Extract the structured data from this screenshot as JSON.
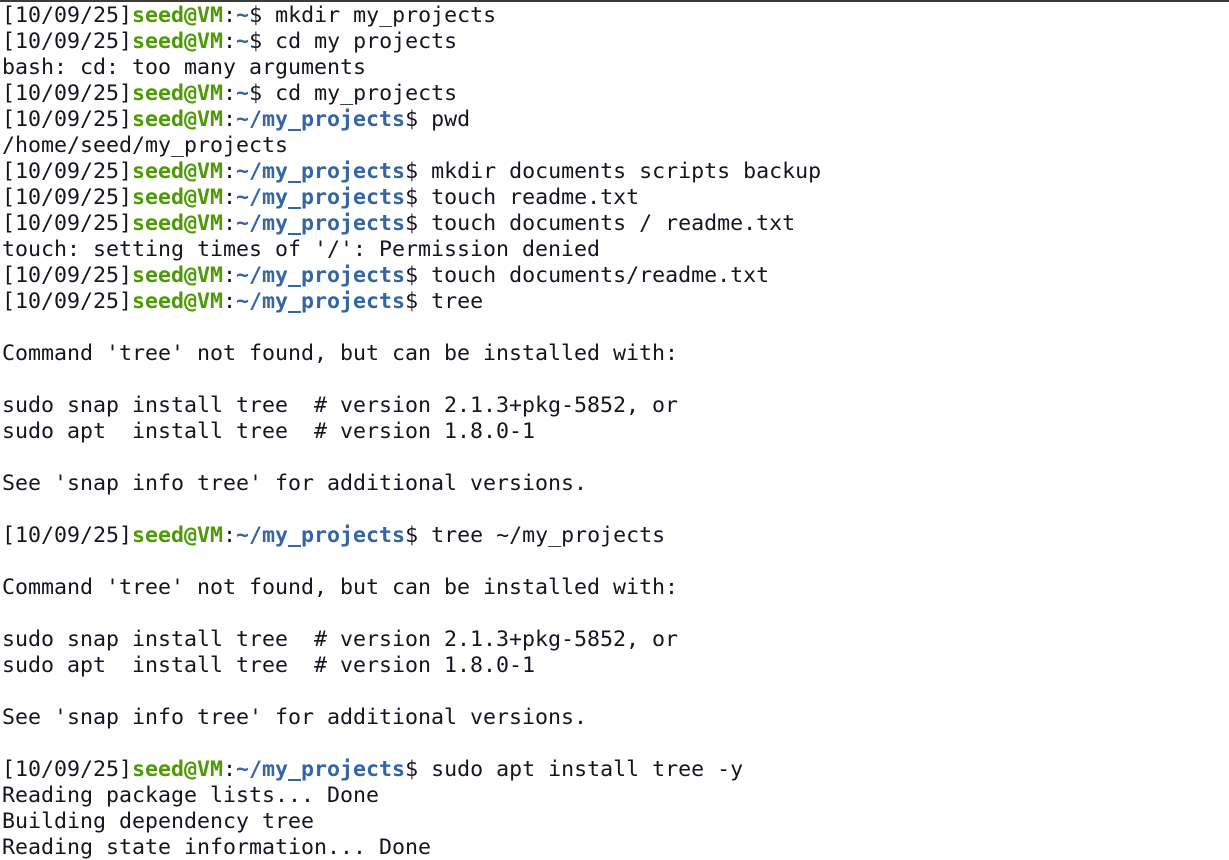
{
  "terminal": {
    "lines": [
      {
        "type": "cmd",
        "ts": "[10/09/25]",
        "user": "seed@VM",
        "sep": ":",
        "path": "~",
        "sym": "$ ",
        "cmd": "mkdir my_projects"
      },
      {
        "type": "cmd",
        "ts": "[10/09/25]",
        "user": "seed@VM",
        "sep": ":",
        "path": "~",
        "sym": "$ ",
        "cmd": "cd my projects"
      },
      {
        "type": "out",
        "text": "bash: cd: too many arguments"
      },
      {
        "type": "cmd",
        "ts": "[10/09/25]",
        "user": "seed@VM",
        "sep": ":",
        "path": "~",
        "sym": "$ ",
        "cmd": "cd my_projects"
      },
      {
        "type": "cmd",
        "ts": "[10/09/25]",
        "user": "seed@VM",
        "sep": ":",
        "path": "~/my_projects",
        "sym": "$ ",
        "cmd": "pwd"
      },
      {
        "type": "out",
        "text": "/home/seed/my_projects"
      },
      {
        "type": "cmd",
        "ts": "[10/09/25]",
        "user": "seed@VM",
        "sep": ":",
        "path": "~/my_projects",
        "sym": "$ ",
        "cmd": "mkdir documents scripts backup"
      },
      {
        "type": "cmd",
        "ts": "[10/09/25]",
        "user": "seed@VM",
        "sep": ":",
        "path": "~/my_projects",
        "sym": "$ ",
        "cmd": "touch readme.txt"
      },
      {
        "type": "cmd",
        "ts": "[10/09/25]",
        "user": "seed@VM",
        "sep": ":",
        "path": "~/my_projects",
        "sym": "$ ",
        "cmd": "touch documents / readme.txt"
      },
      {
        "type": "out",
        "text": "touch: setting times of '/': Permission denied"
      },
      {
        "type": "cmd",
        "ts": "[10/09/25]",
        "user": "seed@VM",
        "sep": ":",
        "path": "~/my_projects",
        "sym": "$ ",
        "cmd": "touch documents/readme.txt"
      },
      {
        "type": "cmd",
        "ts": "[10/09/25]",
        "user": "seed@VM",
        "sep": ":",
        "path": "~/my_projects",
        "sym": "$ ",
        "cmd": "tree"
      },
      {
        "type": "out",
        "text": ""
      },
      {
        "type": "out",
        "text": "Command 'tree' not found, but can be installed with:"
      },
      {
        "type": "out",
        "text": ""
      },
      {
        "type": "out",
        "text": "sudo snap install tree  # version 2.1.3+pkg-5852, or"
      },
      {
        "type": "out",
        "text": "sudo apt  install tree  # version 1.8.0-1"
      },
      {
        "type": "out",
        "text": ""
      },
      {
        "type": "out",
        "text": "See 'snap info tree' for additional versions."
      },
      {
        "type": "out",
        "text": ""
      },
      {
        "type": "cmd",
        "ts": "[10/09/25]",
        "user": "seed@VM",
        "sep": ":",
        "path": "~/my_projects",
        "sym": "$ ",
        "cmd": "tree ~/my_projects"
      },
      {
        "type": "out",
        "text": ""
      },
      {
        "type": "out",
        "text": "Command 'tree' not found, but can be installed with:"
      },
      {
        "type": "out",
        "text": ""
      },
      {
        "type": "out",
        "text": "sudo snap install tree  # version 2.1.3+pkg-5852, or"
      },
      {
        "type": "out",
        "text": "sudo apt  install tree  # version 1.8.0-1"
      },
      {
        "type": "out",
        "text": ""
      },
      {
        "type": "out",
        "text": "See 'snap info tree' for additional versions."
      },
      {
        "type": "out",
        "text": ""
      },
      {
        "type": "cmd",
        "ts": "[10/09/25]",
        "user": "seed@VM",
        "sep": ":",
        "path": "~/my_projects",
        "sym": "$ ",
        "cmd": "sudo apt install tree -y"
      },
      {
        "type": "out",
        "text": "Reading package lists... Done"
      },
      {
        "type": "out",
        "text": "Building dependency tree"
      },
      {
        "type": "out",
        "text": "Reading state information... Done"
      }
    ]
  },
  "colors": {
    "background": "#ffffff",
    "text": "#171421",
    "user_host": "#4e9a06",
    "path": "#3465a4"
  }
}
